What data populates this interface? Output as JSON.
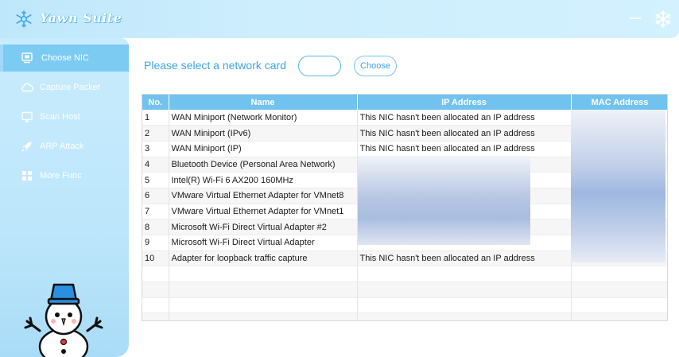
{
  "app": {
    "title": "Yawn Suite"
  },
  "sidebar": {
    "items": [
      {
        "label": "Choose NIC",
        "icon": "monitor-icon",
        "active": true
      },
      {
        "label": "Capture Packet",
        "icon": "cloud-icon",
        "active": false
      },
      {
        "label": "Scan Host",
        "icon": "screen-icon",
        "active": false
      },
      {
        "label": "ARP Attack",
        "icon": "rocket-icon",
        "active": false
      },
      {
        "label": "More Func",
        "icon": "grid-icon",
        "active": false
      }
    ]
  },
  "main": {
    "prompt": "Please select a network card",
    "nic_input": {
      "value": "",
      "placeholder": ""
    },
    "choose_label": "Choose"
  },
  "table": {
    "columns": [
      "No.",
      "Name",
      "IP Address",
      "MAC Address"
    ],
    "rows": [
      [
        "1",
        "WAN Miniport (Network Monitor)",
        "This NIC hasn't been allocated an IP address",
        ""
      ],
      [
        "2",
        "WAN Miniport (IPv6)",
        "This NIC hasn't been allocated an IP address",
        ""
      ],
      [
        "3",
        "WAN Miniport (IP)",
        "This NIC hasn't been allocated an IP address",
        ""
      ],
      [
        "4",
        "Bluetooth Device (Personal Area Network)",
        "",
        ""
      ],
      [
        "5",
        "Intel(R) Wi-Fi 6 AX200 160MHz",
        "",
        ""
      ],
      [
        "6",
        "VMware Virtual Ethernet Adapter for VMnet8",
        "",
        ""
      ],
      [
        "7",
        "VMware Virtual Ethernet Adapter for VMnet1",
        "",
        ""
      ],
      [
        "8",
        "Microsoft Wi-Fi Direct Virtual Adapter #2",
        "",
        ""
      ],
      [
        "9",
        "Microsoft Wi-Fi Direct Virtual Adapter",
        "",
        ""
      ],
      [
        "10",
        "Adapter for loopback traffic capture",
        "This NIC hasn't been allocated an IP address",
        ""
      ],
      [
        "",
        "",
        "",
        ""
      ],
      [
        "",
        "",
        "",
        ""
      ],
      [
        "",
        "",
        "",
        ""
      ],
      [
        "",
        "",
        "",
        ""
      ]
    ]
  },
  "colors": {
    "accent": "#3ba6e4",
    "header": "#71c2ee",
    "sidebar": "#c8ecfd",
    "active_nav": "#7ccbf3"
  }
}
